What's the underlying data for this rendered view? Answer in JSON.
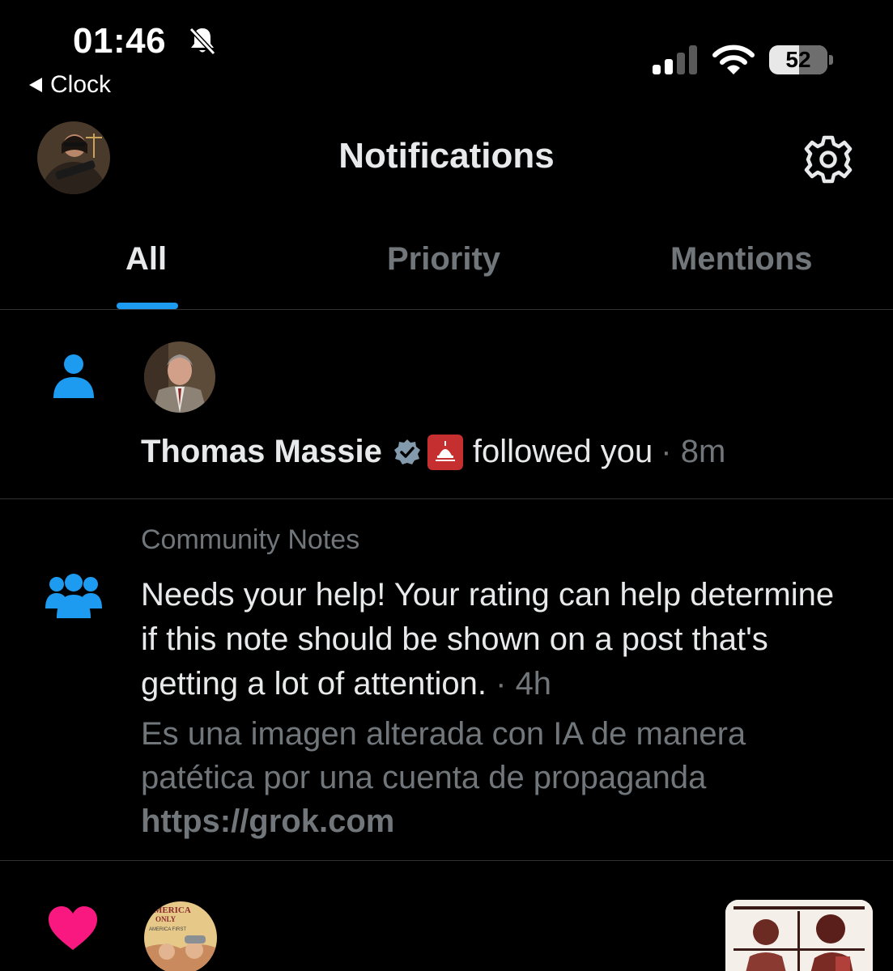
{
  "status_bar": {
    "time": "01:46",
    "back_label": "Clock",
    "battery_level": "52",
    "battery_fraction": 0.52,
    "signal_bars_active": 2,
    "signal_bars_total": 4
  },
  "header": {
    "title": "Notifications"
  },
  "tabs": [
    {
      "label": "All",
      "active": true
    },
    {
      "label": "Priority",
      "active": false
    },
    {
      "label": "Mentions",
      "active": false
    }
  ],
  "notifications": [
    {
      "type": "follow",
      "icon": "person-icon",
      "user_name": "Thomas Massie",
      "action": "followed you",
      "separator": "·",
      "time": "8m"
    },
    {
      "type": "community-notes",
      "icon": "people-icon",
      "label": "Community Notes",
      "message": "Needs your help! Your rating can help determine if this note should be shown on a post that's getting a lot of attention.",
      "separator": "·",
      "time": "4h",
      "note_text": "Es una imagen alterada con IA de manera patética por una cuenta de propaganda",
      "note_link": "https://grok.com"
    },
    {
      "type": "like",
      "icon": "heart-icon",
      "avatar_text": [
        "AMERICA",
        "ONLY",
        "AMERICA FIRST"
      ]
    }
  ],
  "colors": {
    "background": "#000000",
    "accent": "#1d9bf0",
    "text_primary": "#e7e9ea",
    "text_secondary": "#71767b",
    "divider": "#2f3336",
    "like": "#f91880"
  }
}
